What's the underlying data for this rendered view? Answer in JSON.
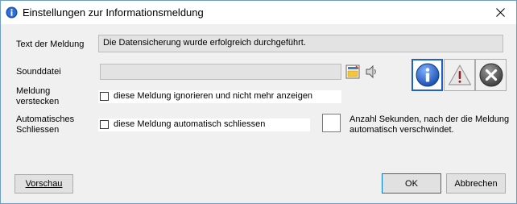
{
  "window": {
    "title": "Einstellungen zur Informationsmeldung"
  },
  "message": {
    "label": "Text der Meldung",
    "value": "Die Datensicherung wurde erfolgreich durchgeführt."
  },
  "sound": {
    "label": "Sounddatei",
    "value": ""
  },
  "hide": {
    "label_line1": "Meldung",
    "label_line2": "verstecken",
    "checkbox_label": "diese Meldung ignorieren und nicht mehr anzeigen",
    "checked": false
  },
  "auto": {
    "label_line1": "Automatisches",
    "label_line2": "Schliessen",
    "checkbox_label": "diese Meldung automatisch schliessen",
    "checked": false,
    "seconds_value": "",
    "seconds_hint_line1": "Anzahl Sekunden, nach der die Meldung",
    "seconds_hint_line2": "automatisch verschwindet."
  },
  "icons": [
    "info-icon",
    "warning-icon",
    "error-icon"
  ],
  "buttons": {
    "preview": "Vorschau",
    "ok": "OK",
    "cancel": "Abbrechen"
  },
  "colors": {
    "accent": "#1e62c9",
    "info": "#2a5fc1",
    "error": "#5a5a5a"
  }
}
